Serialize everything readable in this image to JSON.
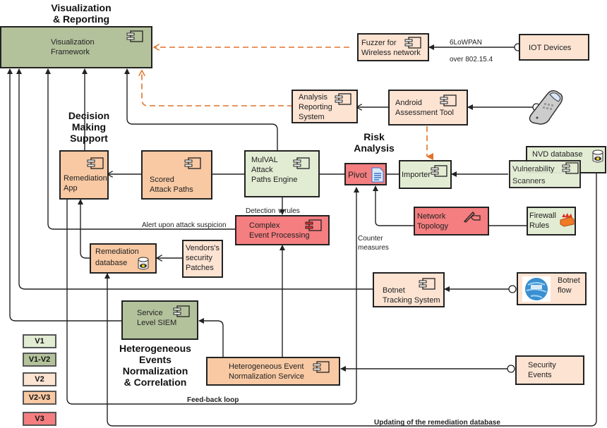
{
  "headings": {
    "visualization_reporting": "Visualization\n& Reporting",
    "decision_making": "Decision\nMaking\nSupport",
    "risk_analysis": "Risk\nAnalysis",
    "heterogeneous": "Heterogeneous\nEvents\nNormalization\n& Correlation"
  },
  "components": {
    "visualization_framework": {
      "label": "Visualization\nFramework",
      "version": "V1-V2"
    },
    "fuzzer": {
      "label": "Fuzzer for\nWireless network",
      "version": "V2"
    },
    "iot_devices": {
      "label": "IOT Devices",
      "version": "V2"
    },
    "analysis_reporting": {
      "label": "Analysis\nReporting\nSystem",
      "version": "V2"
    },
    "android_tool": {
      "label": "Android\nAssessment Tool",
      "version": "V2"
    },
    "remediation_app": {
      "label": "Remediation\nApp",
      "version": "V2-V3"
    },
    "scored_attack_paths": {
      "label": "Scored\nAttack Paths",
      "version": "V2-V3"
    },
    "mulval": {
      "label": "MulVAL\nAttack\nPaths Engine",
      "version": "V1"
    },
    "pivot": {
      "label": "Pivot",
      "version": "V3"
    },
    "importer": {
      "label": "Importer",
      "version": "V1"
    },
    "nvd_database": {
      "label": "NVD database",
      "version": "V1"
    },
    "vulnerability_scanners": {
      "label": "Vulnerability\nScanners",
      "version": "V1"
    },
    "complex_event_processing": {
      "label": "Complex\nEvent Processing",
      "version": "V3"
    },
    "network_topology": {
      "label": "Network\nTopology",
      "version": "V3"
    },
    "firewall_rules": {
      "label": "Firewall\nRules",
      "version": "V1"
    },
    "remediation_database": {
      "label": "Remediation\ndatabase",
      "version": "V2-V3"
    },
    "vendors_patches": {
      "label": "Vendors's\nsecurity\nPatches",
      "version": "V2-V3"
    },
    "botnet_tracking": {
      "label": "Botnet\nTracking System",
      "version": "V2"
    },
    "botnet_flow": {
      "label": "Botnet\nflow",
      "version": "V2"
    },
    "service_siem": {
      "label": "Service\nLevel SIEM",
      "version": "V1-V2"
    },
    "hetero_normalization": {
      "label": "Heterogeneous Event\nNormalization Service",
      "version": "V2-V3"
    },
    "security_events": {
      "label": "Security\nEvents",
      "version": "V2"
    }
  },
  "edge_labels": {
    "sixlowpan": "6LoWPAN",
    "over_802": "over  802.15.4",
    "detection_rules": "Detection ∨ rules",
    "alert": "Alert upon attack suspicion",
    "counter_measures": "Counter\nmeasures",
    "feedback": "Feed-back loop",
    "updating": "Updating of the remediation database"
  },
  "legend": [
    {
      "label": "V1",
      "color": "#e2ecd3"
    },
    {
      "label": "V1-V2",
      "color": "#b4c29c"
    },
    {
      "label": "V2",
      "color": "#fce3d2"
    },
    {
      "label": "V2-V3",
      "color": "#f8c9a3"
    },
    {
      "label": "V3",
      "color": "#f47e80"
    }
  ],
  "colors": {
    "dashed_orange": "#e0732a",
    "line": "#222222"
  },
  "icons": {
    "component": "uml-component-icon",
    "database": "database-cylinder-icon",
    "document": "document-icon",
    "phone": "mobile-phone-icon",
    "firewall": "firewall-icon",
    "globe": "dns-globe-icon",
    "pen": "pen-hand-icon"
  }
}
